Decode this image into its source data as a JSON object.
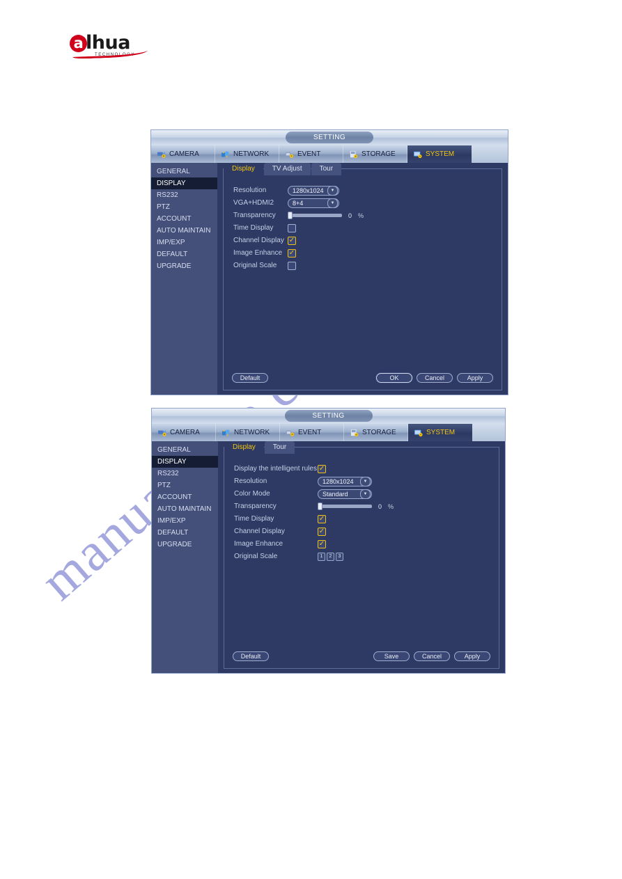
{
  "brand": {
    "logo_main": "lhua",
    "logo_initial": "a",
    "logo_sub": "TECHNOLOGY"
  },
  "watermark": {
    "text": "manualslive.com",
    "color": "#3a41b8"
  },
  "dialogs": [
    {
      "id": "dialog-1",
      "title": "SETTING",
      "tabs": [
        {
          "label": "CAMERA",
          "icon": "camera-icon",
          "active": false
        },
        {
          "label": "NETWORK",
          "icon": "network-icon",
          "active": false
        },
        {
          "label": "EVENT",
          "icon": "event-icon",
          "active": false
        },
        {
          "label": "STORAGE",
          "icon": "storage-icon",
          "active": false
        },
        {
          "label": "SYSTEM",
          "icon": "system-icon",
          "active": true
        }
      ],
      "sidebar": [
        {
          "label": "GENERAL",
          "active": false
        },
        {
          "label": "DISPLAY",
          "active": true
        },
        {
          "label": "RS232",
          "active": false
        },
        {
          "label": "PTZ",
          "active": false
        },
        {
          "label": "ACCOUNT",
          "active": false
        },
        {
          "label": "AUTO MAINTAIN",
          "active": false
        },
        {
          "label": "IMP/EXP",
          "active": false
        },
        {
          "label": "DEFAULT",
          "active": false
        },
        {
          "label": "UPGRADE",
          "active": false
        }
      ],
      "subtabs": [
        {
          "label": "Display",
          "active": true
        },
        {
          "label": "TV Adjust",
          "active": false
        },
        {
          "label": "Tour",
          "active": false
        }
      ],
      "fields": {
        "resolution_label": "Resolution",
        "resolution_value": "1280x1024",
        "vga_label": "VGA+HDMI2",
        "vga_value": "8+4",
        "transparency_label": "Transparency",
        "transparency_value": "0",
        "transparency_unit": "%",
        "time_display_label": "Time Display",
        "channel_display_label": "Channel Display",
        "image_enhance_label": "Image Enhance",
        "original_scale_label": "Original Scale",
        "check_glyph": "✓"
      },
      "buttons": {
        "default": "Default",
        "confirm": "OK",
        "cancel": "Cancel",
        "apply": "Apply"
      }
    },
    {
      "id": "dialog-2",
      "title": "SETTING",
      "tabs": [
        {
          "label": "CAMERA",
          "icon": "camera-icon",
          "active": false
        },
        {
          "label": "NETWORK",
          "icon": "network-icon",
          "active": false
        },
        {
          "label": "EVENT",
          "icon": "event-icon",
          "active": false
        },
        {
          "label": "STORAGE",
          "icon": "storage-icon",
          "active": false
        },
        {
          "label": "SYSTEM",
          "icon": "system-icon",
          "active": true
        }
      ],
      "sidebar": [
        {
          "label": "GENERAL",
          "active": false
        },
        {
          "label": "DISPLAY",
          "active": true
        },
        {
          "label": "RS232",
          "active": false
        },
        {
          "label": "PTZ",
          "active": false
        },
        {
          "label": "ACCOUNT",
          "active": false
        },
        {
          "label": "AUTO MAINTAIN",
          "active": false
        },
        {
          "label": "IMP/EXP",
          "active": false
        },
        {
          "label": "DEFAULT",
          "active": false
        },
        {
          "label": "UPGRADE",
          "active": false
        }
      ],
      "subtabs": [
        {
          "label": "Display",
          "active": true
        },
        {
          "label": "Tour",
          "active": false
        }
      ],
      "fields": {
        "intelligent_rules_label": "Display the intelligent rules",
        "resolution_label": "Resolution",
        "resolution_value": "1280x1024",
        "color_mode_label": "Color Mode",
        "color_mode_value": "Standard",
        "transparency_label": "Transparency",
        "transparency_value": "0",
        "transparency_unit": "%",
        "time_display_label": "Time Display",
        "channel_display_label": "Channel Display",
        "image_enhance_label": "Image Enhance",
        "original_scale_label": "Original Scale",
        "original_scale_channels": [
          "1",
          "2",
          "3"
        ],
        "check_glyph": "✓"
      },
      "buttons": {
        "default": "Default",
        "confirm": "Save",
        "cancel": "Cancel",
        "apply": "Apply"
      }
    }
  ]
}
